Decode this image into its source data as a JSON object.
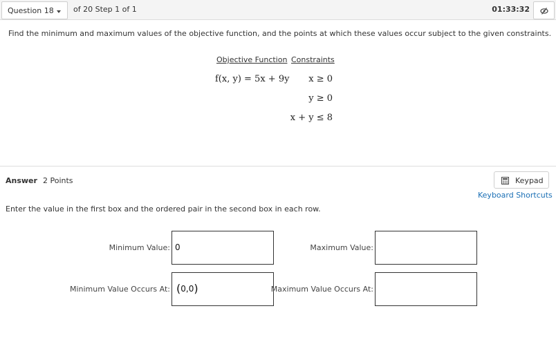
{
  "header": {
    "question_label": "Question 18",
    "step_text": "of 20 Step 1 of 1",
    "timer": "01:33:32"
  },
  "question": {
    "prompt": "Find the minimum and maximum values of the objective function, and the points at which these values occur subject to the given constraints.",
    "objective_header": "Objective Function",
    "constraints_header": "Constraints",
    "objective": "f(x, y) = 5x + 9y",
    "constraints": [
      "x ≥ 0",
      "y ≥ 0",
      "x + y ≤ 8"
    ]
  },
  "answer": {
    "label": "Answer",
    "points": "2 Points",
    "keypad_label": "Keypad",
    "shortcuts_label": "Keyboard Shortcuts",
    "instruction": "Enter the value in the first box and the ordered pair in the second box in each row.",
    "fields": {
      "min_value_label": "Minimum Value:",
      "min_value": "0",
      "max_value_label": "Maximum Value:",
      "max_value": "",
      "min_at_label": "Minimum Value Occurs At:",
      "min_at_value": "0,0",
      "max_at_label": "Maximum Value Occurs At:",
      "max_at_value": ""
    }
  }
}
